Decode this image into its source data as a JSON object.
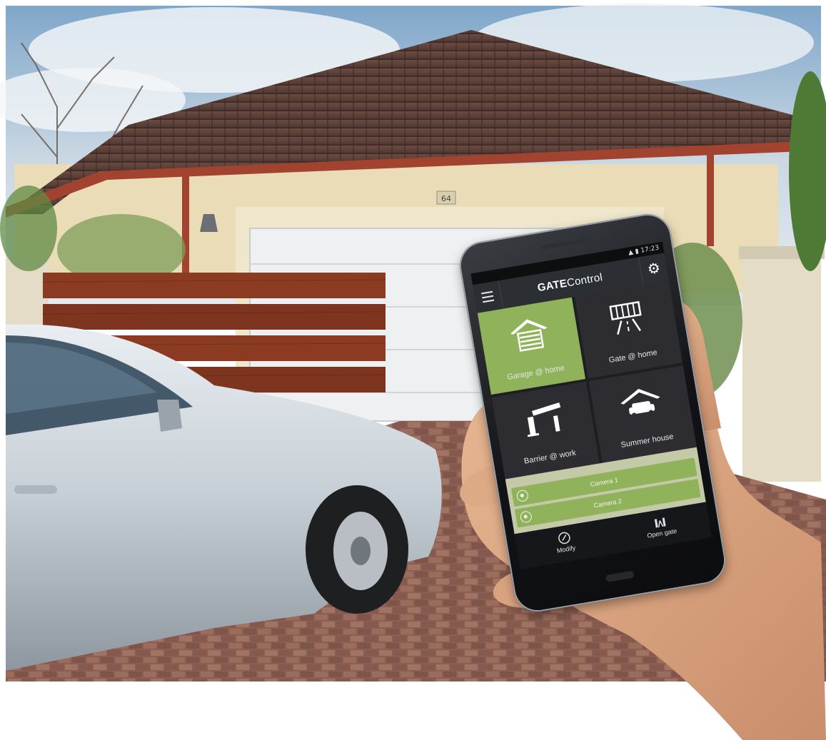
{
  "photo": {
    "house_number": "64"
  },
  "phone": {
    "status": {
      "time": "17:23"
    },
    "app": {
      "title_bold": "GATE",
      "title_regular": "Control",
      "menu_icon": "hamburger-menu-icon",
      "settings_icon": "gear-icon"
    },
    "tiles": [
      {
        "label": "Garage @ home",
        "icon": "garage-icon",
        "active": true
      },
      {
        "label": "Gate @ home",
        "icon": "sliding-gate-icon",
        "active": false
      },
      {
        "label": "Barrier @ work",
        "icon": "barrier-icon",
        "active": false
      },
      {
        "label": "Summer house",
        "icon": "carport-icon",
        "active": false
      }
    ],
    "cameras": [
      {
        "label": "Camera 1",
        "icon": "camera-icon"
      },
      {
        "label": "Camera 2",
        "icon": "camera-icon"
      }
    ],
    "bottom_bar": {
      "modify_label": "Modify",
      "modify_icon": "edit-icon",
      "open_gate_label": "Open gate",
      "open_gate_icon": "open-gate-icon"
    }
  },
  "colors": {
    "accent_green": "#8fb25a",
    "tile_dark": "#2d2d31",
    "appbar": "#2b2e33"
  }
}
